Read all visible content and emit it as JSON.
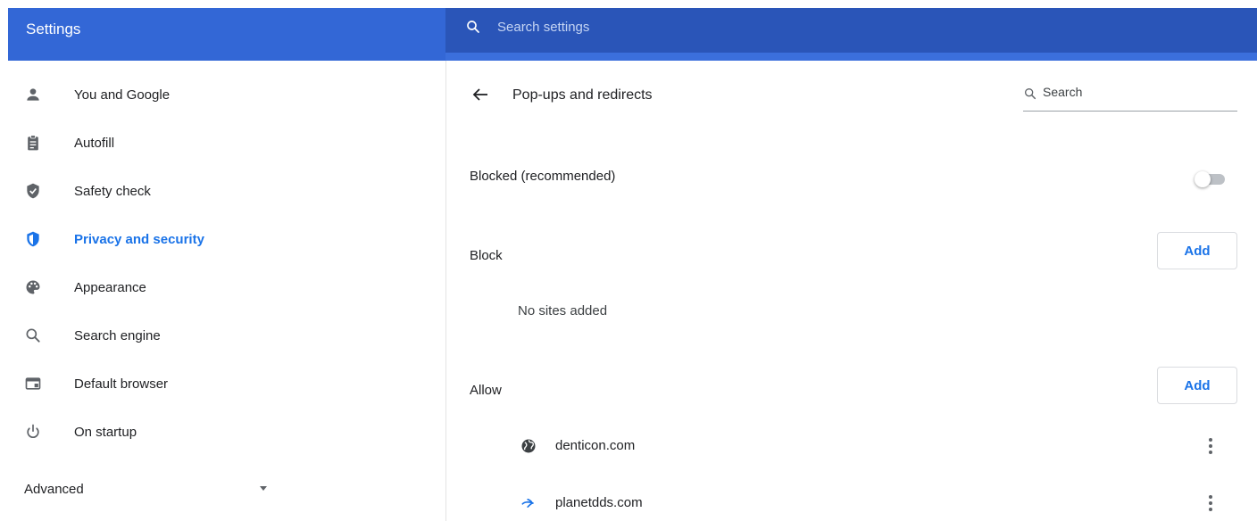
{
  "header": {
    "title": "Settings",
    "search_placeholder": "Search settings"
  },
  "sidebar": {
    "items": [
      {
        "label": "You and Google",
        "icon": "person-icon"
      },
      {
        "label": "Autofill",
        "icon": "clipboard-icon"
      },
      {
        "label": "Safety check",
        "icon": "shield-check-icon"
      },
      {
        "label": "Privacy and security",
        "icon": "shield-privacy-icon",
        "active": true
      },
      {
        "label": "Appearance",
        "icon": "palette-icon"
      },
      {
        "label": "Search engine",
        "icon": "search-icon"
      },
      {
        "label": "Default browser",
        "icon": "browser-window-icon"
      },
      {
        "label": "On startup",
        "icon": "power-icon"
      }
    ],
    "advanced_label": "Advanced"
  },
  "main": {
    "title": "Pop-ups and redirects",
    "search_placeholder": "Search",
    "blocked_label": "Blocked (recommended)",
    "blocked_toggle_on": false,
    "block_section": {
      "label": "Block",
      "add_label": "Add",
      "empty_text": "No sites added"
    },
    "allow_section": {
      "label": "Allow",
      "add_label": "Add",
      "sites": [
        {
          "name": "denticon.com",
          "icon": "globe-icon"
        },
        {
          "name": "planetdds.com",
          "icon": "planet-logo-icon"
        }
      ]
    }
  },
  "colors": {
    "header_left": "#3367d6",
    "header_right": "#2a55b8",
    "accent": "#1a73e8"
  }
}
